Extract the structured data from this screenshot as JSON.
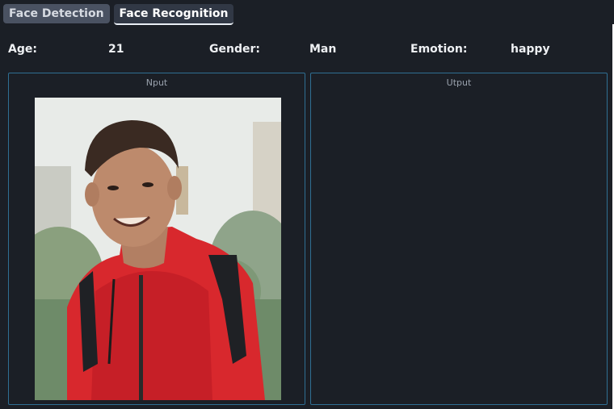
{
  "tabs": [
    {
      "label": "Face Detection",
      "active": false
    },
    {
      "label": "Face Recognition",
      "active": true
    }
  ],
  "info": {
    "age_label": "Age:",
    "age_value": "21",
    "gender_label": "Gender:",
    "gender_value": "Man",
    "emotion_label": "Emotion:",
    "emotion_value": "happy"
  },
  "panels": {
    "input_title": "Nput",
    "output_title": "Utput"
  },
  "colors": {
    "background": "#1b1f26",
    "panel_border": "#2f6f93",
    "tab_inactive": "#4a5262",
    "tab_active": "#313845"
  }
}
